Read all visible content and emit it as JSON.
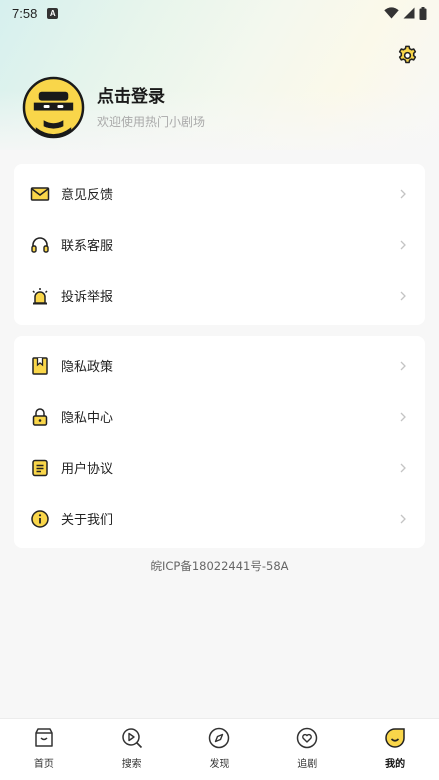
{
  "status": {
    "time": "7:58",
    "badge": "A"
  },
  "profile": {
    "title": "点击登录",
    "subtitle": "欢迎使用热门小剧场"
  },
  "menu_group_1": [
    {
      "label": "意见反馈",
      "icon": "mail-icon"
    },
    {
      "label": "联系客服",
      "icon": "headset-icon"
    },
    {
      "label": "投诉举报",
      "icon": "alarm-icon"
    }
  ],
  "menu_group_2": [
    {
      "label": "隐私政策",
      "icon": "bookmark-icon"
    },
    {
      "label": "隐私中心",
      "icon": "lock-icon"
    },
    {
      "label": "用户协议",
      "icon": "document-icon"
    },
    {
      "label": "关于我们",
      "icon": "info-icon"
    }
  ],
  "icp": "皖ICP备18022441号-58A",
  "tabs": [
    {
      "label": "首页",
      "icon": "home-icon",
      "active": false
    },
    {
      "label": "搜索",
      "icon": "search-icon",
      "active": false
    },
    {
      "label": "发现",
      "icon": "compass-icon",
      "active": false
    },
    {
      "label": "追剧",
      "icon": "heart-icon",
      "active": false
    },
    {
      "label": "我的",
      "icon": "profile-smile-icon",
      "active": true
    }
  ],
  "colors": {
    "accent": "#f9d64a",
    "icon_stroke": "#222222",
    "background": "#f7f7f7"
  }
}
